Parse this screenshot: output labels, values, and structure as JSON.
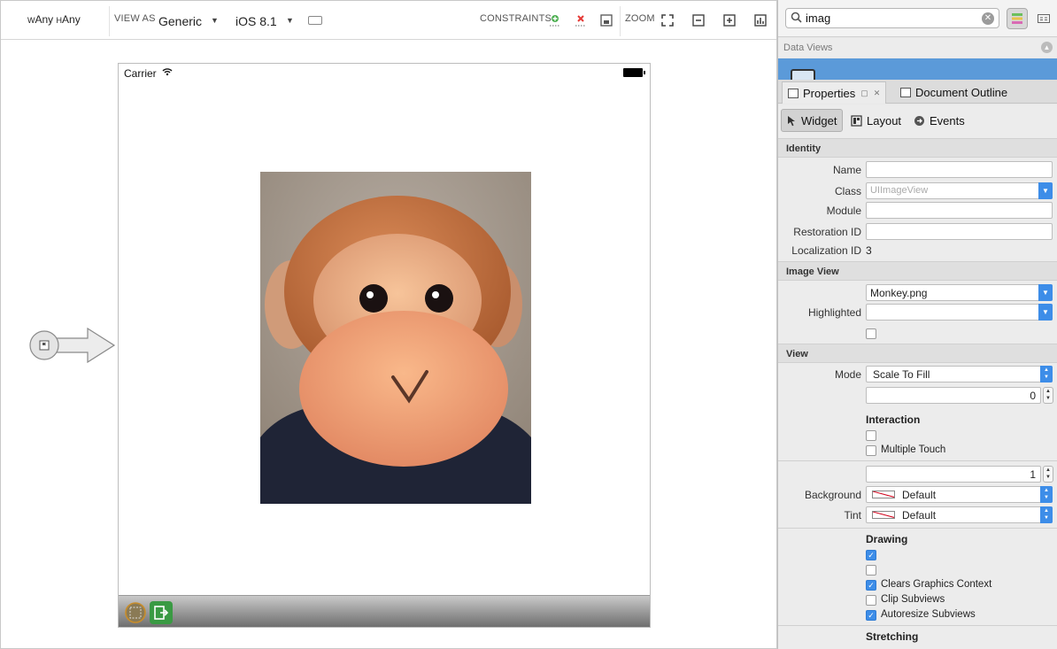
{
  "toolbar": {
    "size_class": {
      "w_prefix": "W",
      "w_value": "Any",
      "h_prefix": "H",
      "h_value": "Any"
    },
    "view_as_label": "VIEW AS",
    "device": "Generic",
    "ios_version": "iOS 8.1",
    "constraints_label": "CONSTRAINTS",
    "zoom_label": "ZOOM"
  },
  "canvas": {
    "status_bar": {
      "carrier": "Carrier"
    },
    "image_view": {
      "image": "Monkey.png"
    }
  },
  "search": {
    "value": "imag"
  },
  "toolbox": {
    "section_label": "Data Views"
  },
  "panel_tabs": [
    {
      "label": "Properties"
    },
    {
      "label": "Document Outline"
    }
  ],
  "inspector_tabs": [
    {
      "label": "Widget"
    },
    {
      "label": "Layout"
    },
    {
      "label": "Events"
    }
  ],
  "identity": {
    "section": "Identity",
    "name_label": "Name",
    "class_label": "Class",
    "class_placeholder": "UIImageView",
    "module_label": "Module",
    "restoration_label": "Restoration ID",
    "localization_label": "Localization ID",
    "localization_value": "3"
  },
  "image_view": {
    "section": "Image View",
    "image_value": "Monkey.png",
    "highlighted_label": "Highlighted"
  },
  "view": {
    "section": "View",
    "mode_label": "Mode",
    "mode_value": "Scale To Fill",
    "tag_value": "0",
    "interaction_label": "Interaction",
    "multiple_touch_label": "Multiple Touch",
    "alpha_value": "1",
    "background_label": "Background",
    "background_value": "Default",
    "tint_label": "Tint",
    "tint_value": "Default",
    "drawing_label": "Drawing",
    "clears_label": "Clears Graphics Context",
    "clip_label": "Clip Subviews",
    "autoresize_label": "Autoresize Subviews",
    "stretching_label": "Stretching"
  },
  "colors": {
    "accent": "#3d8de8",
    "selection": "#5b9ad9",
    "panel_bg": "#ececec"
  }
}
